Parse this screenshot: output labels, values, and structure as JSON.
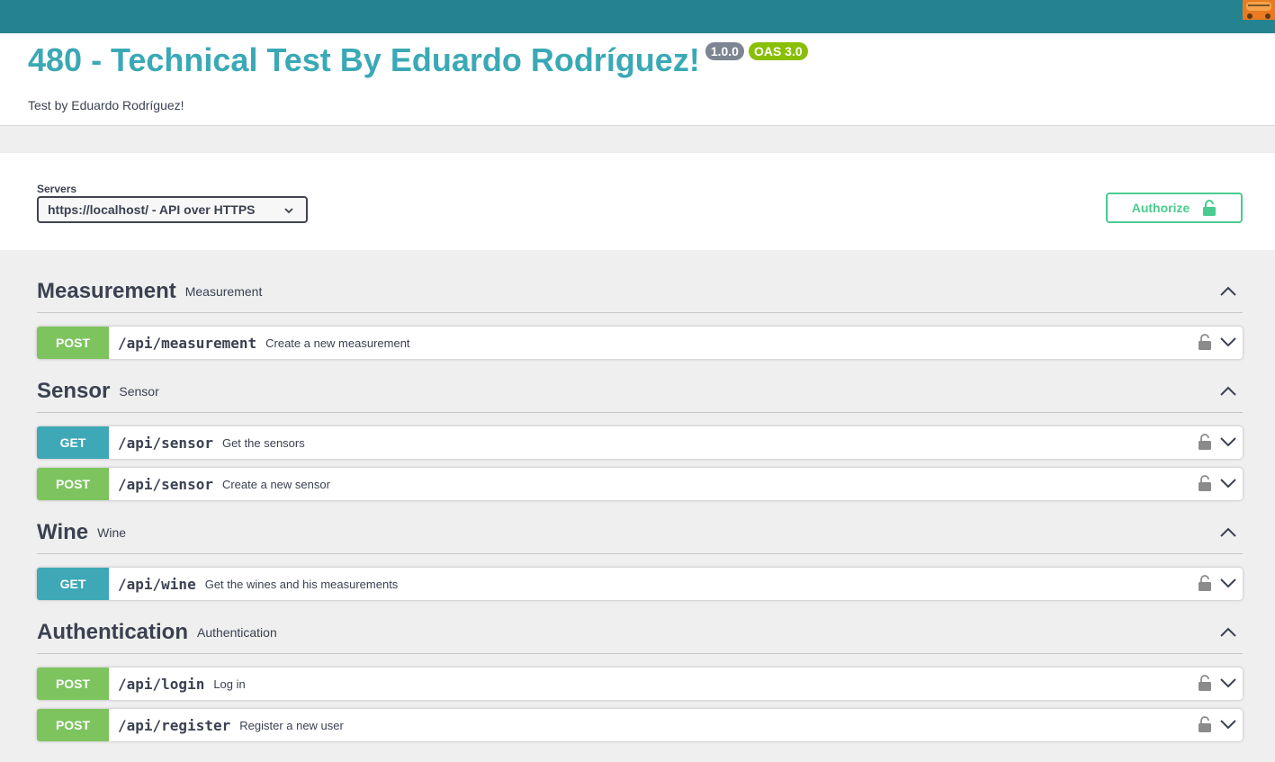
{
  "info": {
    "title": "480 - Technical Test By Eduardo Rodríguez!",
    "version": "1.0.0",
    "oas": "OAS 3.0",
    "description": "Test by Eduardo Rodríguez!"
  },
  "servers": {
    "label": "Servers",
    "selected": "https://localhost/ - API over HTTPS"
  },
  "authorize": {
    "label": "Authorize"
  },
  "colors": {
    "topbar": "#258390",
    "title": "#3aa9b5",
    "post": "#7dc45f",
    "get": "#3ea8b7",
    "authorize": "#49cc90"
  },
  "tags": [
    {
      "name": "Measurement",
      "description": "Measurement",
      "operations": [
        {
          "method": "POST",
          "path": "/api/measurement",
          "summary": "Create a new measurement"
        }
      ]
    },
    {
      "name": "Sensor",
      "description": "Sensor",
      "operations": [
        {
          "method": "GET",
          "path": "/api/sensor",
          "summary": "Get the sensors"
        },
        {
          "method": "POST",
          "path": "/api/sensor",
          "summary": "Create a new sensor"
        }
      ]
    },
    {
      "name": "Wine",
      "description": "Wine",
      "operations": [
        {
          "method": "GET",
          "path": "/api/wine",
          "summary": "Get the wines and his measurements"
        }
      ]
    },
    {
      "name": "Authentication",
      "description": "Authentication",
      "operations": [
        {
          "method": "POST",
          "path": "/api/login",
          "summary": "Log in"
        },
        {
          "method": "POST",
          "path": "/api/register",
          "summary": "Register a new user"
        }
      ]
    }
  ],
  "icons": {
    "lock": "lock-icon",
    "chevron": "chevron-down-icon",
    "collapse": "chevron-up-icon"
  }
}
